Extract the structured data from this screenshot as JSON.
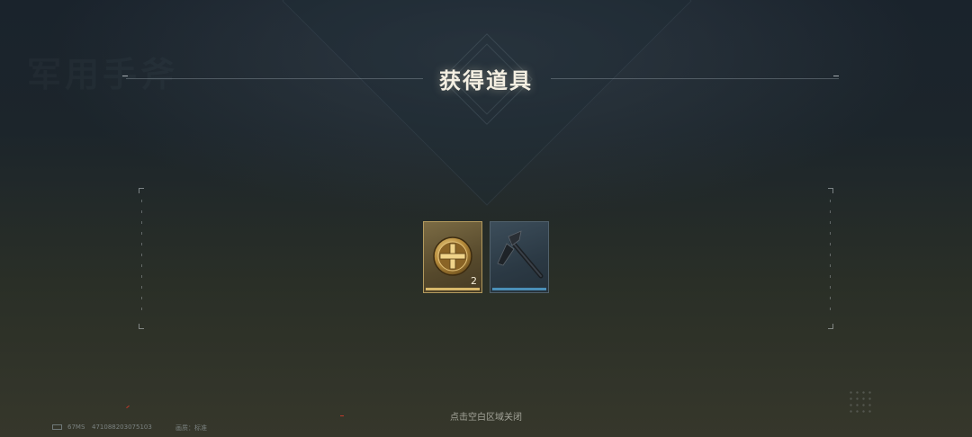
{
  "dialog": {
    "title": "获得道具",
    "close_hint": "点击空白区域关闭"
  },
  "background": {
    "ghost_text": "军用手斧"
  },
  "items": [
    {
      "icon": "gold-cross-medal-icon",
      "quantity": "2",
      "rarity_color": "#d8b86a"
    },
    {
      "icon": "tactical-axe-icon",
      "quantity": "",
      "rarity_color": "#4a8fb8"
    }
  ],
  "status_bar": {
    "ping": "67MS",
    "uid": "471088203075103",
    "quality": "画质：标准"
  }
}
